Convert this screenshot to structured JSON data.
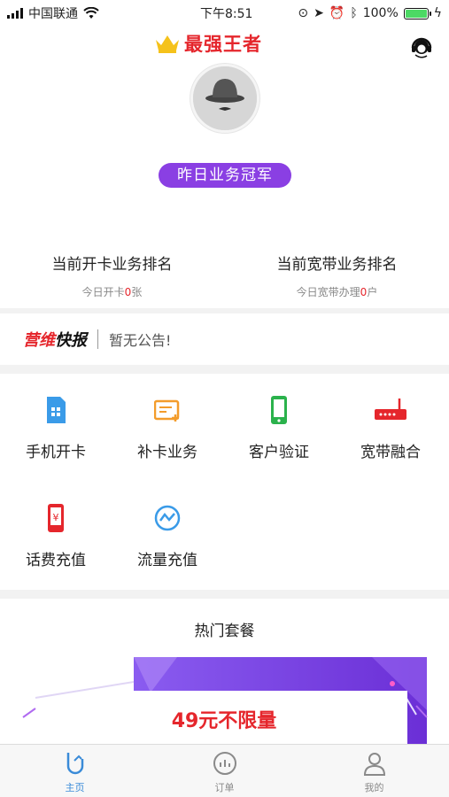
{
  "status_bar": {
    "carrier": "中国联通",
    "time": "下午8:51",
    "battery": "100%"
  },
  "header": {
    "brand": "最强王者",
    "champion_badge": "昨日业务冠军"
  },
  "rankings": [
    {
      "title": "当前开卡业务排名",
      "prefix": "今日开卡",
      "count": "0",
      "unit": "张"
    },
    {
      "title": "当前宽带业务排名",
      "prefix": "今日宽带办理",
      "count": "0",
      "unit": "户"
    }
  ],
  "notice": {
    "brand_red": "营维",
    "brand_black": "快报",
    "text": "暂无公告!"
  },
  "services": [
    {
      "label": "手机开卡",
      "icon": "sim-card-icon",
      "color": "#3a9be8"
    },
    {
      "label": "补卡业务",
      "icon": "card-add-icon",
      "color": "#f39c2b"
    },
    {
      "label": "客户验证",
      "icon": "phone-verify-icon",
      "color": "#2bb24c"
    },
    {
      "label": "宽带融合",
      "icon": "router-icon",
      "color": "#e5262c"
    },
    {
      "label": "话费充值",
      "icon": "phone-yuan-icon",
      "color": "#e5262c"
    },
    {
      "label": "流量充值",
      "icon": "data-flow-icon",
      "color": "#3a9be8"
    }
  ],
  "hot_packages": {
    "title": "热门套餐",
    "banner_price": "49元不限量"
  },
  "tabbar": [
    {
      "label": "主页",
      "icon": "home-icon"
    },
    {
      "label": "订单",
      "icon": "order-icon"
    },
    {
      "label": "我的",
      "icon": "profile-icon"
    }
  ],
  "colors": {
    "accent_red": "#e5262c",
    "badge_purple": "#8a3fe3",
    "tab_active": "#3a8bd8"
  }
}
